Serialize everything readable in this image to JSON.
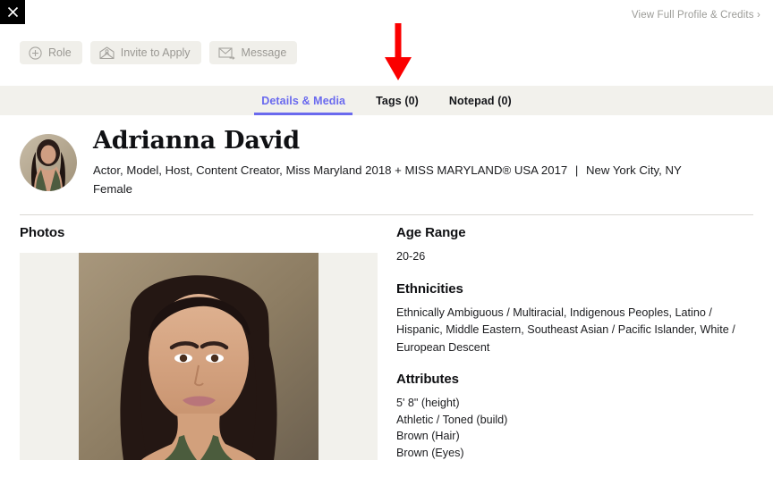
{
  "topbar": {
    "close_icon": "close-icon",
    "full_profile_link": "View Full Profile & Credits ›"
  },
  "actions": [
    {
      "label": "Role",
      "icon": "plus-circle-icon"
    },
    {
      "label": "Invite to Apply",
      "icon": "open-envelope-person-icon"
    },
    {
      "label": "Message",
      "icon": "envelope-arrow-icon"
    }
  ],
  "annotation": {
    "type": "arrow",
    "direction": "down",
    "color": "#fb0000",
    "points_at": "Tags (0)"
  },
  "tabs": [
    {
      "label": "Details & Media",
      "active": true
    },
    {
      "label": "Tags (0)",
      "active": false
    },
    {
      "label": "Notepad (0)",
      "active": false
    }
  ],
  "profile": {
    "name": "Adrianna David",
    "roles": "Actor, Model, Host, Content Creator, Miss Maryland 2018 + MISS MARYLAND® USA 2017",
    "separator": "|",
    "location": "New York City, NY",
    "gender": "Female",
    "avatar_alt": "avatar"
  },
  "left_column": {
    "photos_title": "Photos"
  },
  "right_column": {
    "age_range_title": "Age Range",
    "age_range_value": "20-26",
    "ethnicities_title": "Ethnicities",
    "ethnicities_value": "Ethnically Ambiguous / Multiracial, Indigenous Peoples, Latino / Hispanic, Middle Eastern, Southeast Asian / Pacific Islander, White / European Descent",
    "attributes_title": "Attributes",
    "attributes": [
      "5' 8\" (height)",
      "Athletic / Toned (build)",
      "Brown (Hair)",
      "Brown (Eyes)"
    ]
  },
  "colors": {
    "tabstrip_bg": "#f2f1ec",
    "active_tab": "#6a6aee",
    "button_bg": "#f0efea",
    "button_text": "#9a9893",
    "link_text": "#9b9b97",
    "annotation": "#fb0000"
  }
}
